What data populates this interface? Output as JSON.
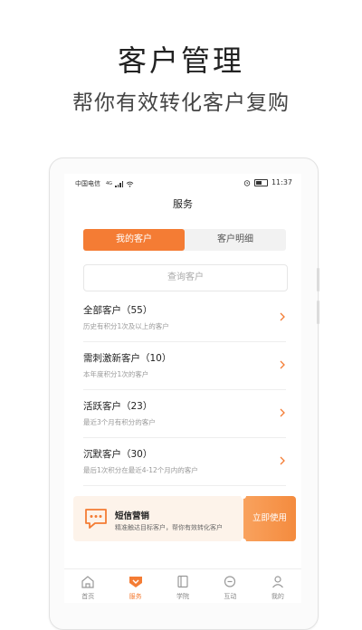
{
  "hero": {
    "title": "客户管理",
    "subtitle": "帮你有效转化客户复购"
  },
  "statusbar": {
    "carrier": "中国电信",
    "network": "4G",
    "time": "11:37"
  },
  "page_title": "服务",
  "segment": {
    "tabs": [
      {
        "label": "我的客户",
        "active": true
      },
      {
        "label": "客户明细",
        "active": false
      }
    ]
  },
  "search": {
    "placeholder": "查询客户"
  },
  "customer_groups": [
    {
      "title": "全部客户（55）",
      "desc": "历史有积分1次及以上的客户"
    },
    {
      "title": "需刺激新客户（10）",
      "desc": "本年度积分1次的客户"
    },
    {
      "title": "活跃客户（23）",
      "desc": "最近3个月有积分的客户"
    },
    {
      "title": "沉默客户（30）",
      "desc": "最后1次积分在最近4-12个月内的客户"
    }
  ],
  "banner": {
    "title": "短信营销",
    "desc": "精准触达目标客户，帮你有效转化客户",
    "button": "立即使用",
    "icon": "message-icon"
  },
  "tabbar": {
    "items": [
      {
        "label": "首页",
        "icon": "home-icon",
        "active": false
      },
      {
        "label": "服务",
        "icon": "service-icon",
        "active": true
      },
      {
        "label": "学院",
        "icon": "book-icon",
        "active": false
      },
      {
        "label": "互动",
        "icon": "chat-icon",
        "active": false
      },
      {
        "label": "我的",
        "icon": "profile-icon",
        "active": false
      }
    ]
  },
  "colors": {
    "accent": "#f47c34",
    "banner_bg": "#fdf3ea"
  }
}
